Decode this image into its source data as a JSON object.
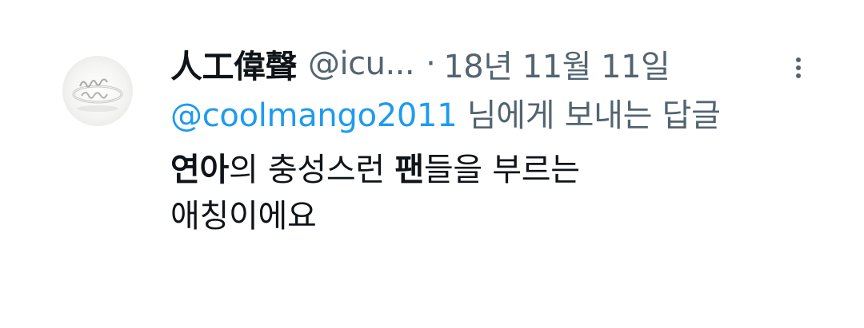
{
  "tweet": {
    "display_name": "人工偉聲",
    "handle": "@icu...",
    "separator": "·",
    "timestamp": "18년 11월 11일",
    "more_icon": "more-vertical-icon",
    "replying_to": {
      "mention": "@coolmango2011",
      "suffix": " 님에게 보내는 답글"
    },
    "text": {
      "line1_bold_a": "연아",
      "line1_part_b": "의 충성스런 ",
      "line1_bold_c": "팬",
      "line1_part_d": "들을 부르는",
      "line2": "애칭이에요"
    }
  },
  "colors": {
    "text_primary": "#0f1419",
    "text_secondary": "#536471",
    "link": "#1d9bf0"
  }
}
